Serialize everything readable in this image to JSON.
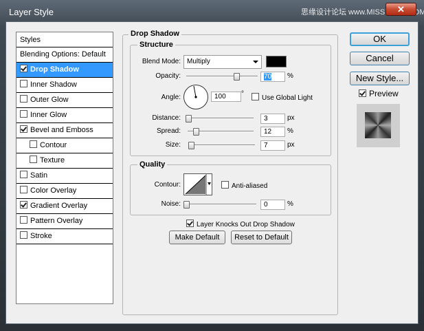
{
  "window": {
    "title": "Layer Style",
    "watermark": "思缘设计论坛 www.MISSYUAN.COM",
    "close_glyph": "✕"
  },
  "styles_panel": {
    "header": "Styles",
    "items": [
      {
        "label": "Blending Options: Default",
        "checkbox": false,
        "checked": false,
        "indent": false,
        "selected": false
      },
      {
        "label": "Drop Shadow",
        "checkbox": true,
        "checked": true,
        "indent": false,
        "selected": true
      },
      {
        "label": "Inner Shadow",
        "checkbox": true,
        "checked": false,
        "indent": false,
        "selected": false
      },
      {
        "label": "Outer Glow",
        "checkbox": true,
        "checked": false,
        "indent": false,
        "selected": false
      },
      {
        "label": "Inner Glow",
        "checkbox": true,
        "checked": false,
        "indent": false,
        "selected": false
      },
      {
        "label": "Bevel and Emboss",
        "checkbox": true,
        "checked": true,
        "indent": false,
        "selected": false
      },
      {
        "label": "Contour",
        "checkbox": true,
        "checked": false,
        "indent": true,
        "selected": false
      },
      {
        "label": "Texture",
        "checkbox": true,
        "checked": false,
        "indent": true,
        "selected": false
      },
      {
        "label": "Satin",
        "checkbox": true,
        "checked": false,
        "indent": false,
        "selected": false
      },
      {
        "label": "Color Overlay",
        "checkbox": true,
        "checked": false,
        "indent": false,
        "selected": false
      },
      {
        "label": "Gradient Overlay",
        "checkbox": true,
        "checked": true,
        "indent": false,
        "selected": false
      },
      {
        "label": "Pattern Overlay",
        "checkbox": true,
        "checked": false,
        "indent": false,
        "selected": false
      },
      {
        "label": "Stroke",
        "checkbox": true,
        "checked": false,
        "indent": false,
        "selected": false
      }
    ]
  },
  "drop_shadow": {
    "title": "Drop Shadow",
    "structure": {
      "title": "Structure",
      "blend_mode_label": "Blend Mode:",
      "blend_mode_value": "Multiply",
      "color": "#000000",
      "opacity_label": "Opacity:",
      "opacity_value": "70",
      "opacity_unit": "%",
      "opacity_level": 0.7,
      "angle_label": "Angle:",
      "angle_value": "100",
      "angle_unit": "°",
      "use_global_light_label": "Use Global Light",
      "use_global_light_checked": false,
      "distance_label": "Distance:",
      "distance_value": "3",
      "distance_unit": "px",
      "distance_level": 0.01,
      "spread_label": "Spread:",
      "spread_value": "12",
      "spread_unit": "%",
      "spread_level": 0.12,
      "size_label": "Size:",
      "size_value": "7",
      "size_unit": "px",
      "size_level": 0.03
    },
    "quality": {
      "title": "Quality",
      "contour_label": "Contour:",
      "anti_aliased_label": "Anti-aliased",
      "anti_aliased_checked": false,
      "noise_label": "Noise:",
      "noise_value": "0",
      "noise_unit": "%",
      "noise_level": 0.0
    },
    "knockout_label": "Layer Knocks Out Drop Shadow",
    "knockout_checked": true,
    "make_default_label": "Make Default",
    "reset_default_label": "Reset to Default"
  },
  "buttons": {
    "ok": "OK",
    "cancel": "Cancel",
    "new_style": "New Style..."
  },
  "preview": {
    "label": "Preview",
    "checked": true
  },
  "colors": {
    "selection": "#3399ff",
    "dialog_bg": "#efefef"
  }
}
